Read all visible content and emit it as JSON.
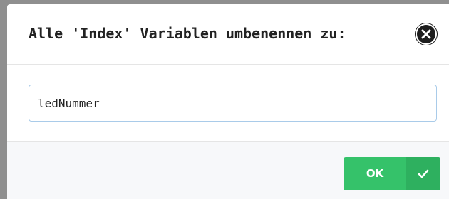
{
  "dialog": {
    "title": "Alle 'Index' Variablen umbenennen zu:",
    "close_icon": "close-icon",
    "input_value": "ledNummer",
    "ok_label": "OK",
    "ok_icon": "check-icon"
  },
  "colors": {
    "ok_button": "#35c26a",
    "ok_icon_bg": "#2eb05f",
    "input_border": "#a9cbe9",
    "footer_bg": "#f7f8fa",
    "close_bg": "#1e1e1e"
  }
}
